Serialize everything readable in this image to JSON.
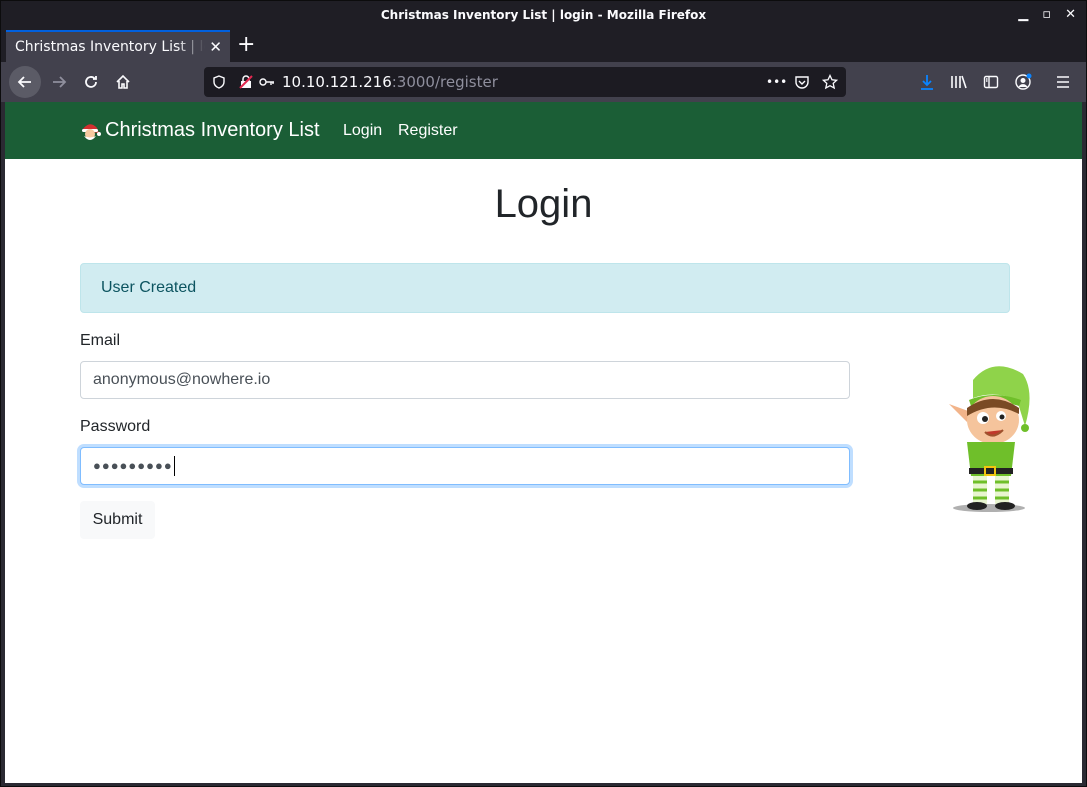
{
  "window": {
    "title": "Christmas Inventory List | login - Mozilla Firefox"
  },
  "tab": {
    "title": "Christmas Inventory List | login",
    "close": "✕",
    "new_tab": "+"
  },
  "urlbar": {
    "host": "10.10.121.216",
    "rest": ":3000/register",
    "more": "•••"
  },
  "site": {
    "brand": "Christmas Inventory List",
    "nav": {
      "login": "Login",
      "register": "Register"
    }
  },
  "page": {
    "heading": "Login",
    "alert": "User Created",
    "email_label": "Email",
    "email_value": "anonymous@nowhere.io",
    "password_label": "Password",
    "password_value": "●●●●●●●●●",
    "submit_label": "Submit"
  },
  "colors": {
    "navbar": "#1b5e36",
    "alert_bg": "#d1ecf1",
    "alert_text": "#0c5460",
    "focus_ring": "#80bdff"
  },
  "icons": [
    "back-icon",
    "forward-icon",
    "reload-icon",
    "home-icon",
    "shield-icon",
    "insecure-lock-icon",
    "key-icon",
    "pocket-icon",
    "star-icon",
    "download-icon",
    "library-icon",
    "sidebar-icon",
    "account-icon",
    "menu-icon",
    "santa-icon",
    "elf-illustration"
  ]
}
